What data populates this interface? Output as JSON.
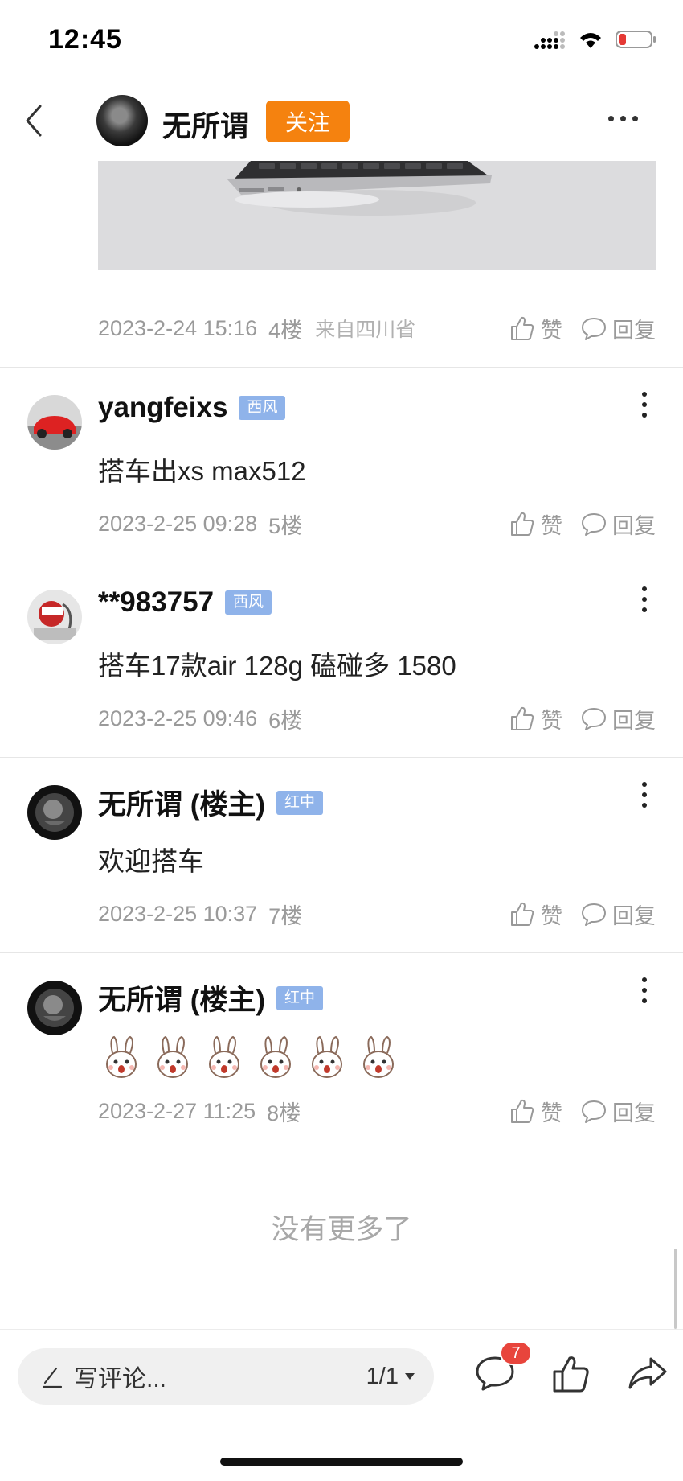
{
  "status_bar": {
    "time": "12:45"
  },
  "header": {
    "author_name": "无所谓",
    "follow_label": "关注"
  },
  "post": {
    "date": "2023-2-24 15:16",
    "floor": "4楼",
    "location": "来自四川省"
  },
  "actions": {
    "like_label": "赞",
    "reply_label": "回复"
  },
  "comments": [
    {
      "name": "yangfeixs",
      "badge": "西风",
      "text": "搭车出xs max512",
      "date": "2023-2-25 09:28",
      "floor": "5楼"
    },
    {
      "name": "**983757",
      "badge": "西风",
      "text": "搭车17款air 128g 磕碰多 1580",
      "date": "2023-2-25 09:46",
      "floor": "6楼"
    },
    {
      "name": "无所谓 (楼主)",
      "badge": "红中",
      "text": "欢迎搭车",
      "date": "2023-2-25 10:37",
      "floor": "7楼"
    },
    {
      "name": "无所谓 (楼主)",
      "badge": "红中",
      "text": "",
      "date": "2023-2-27 11:25",
      "floor": "8楼"
    }
  ],
  "footer": {
    "no_more": "没有更多了"
  },
  "bottom_bar": {
    "input_placeholder": "写评论...",
    "page_indicator": "1/1",
    "comment_count": "7"
  },
  "colors": {
    "follow_orange": "#f5820f",
    "badge_blue": "#8fb3ea",
    "count_red": "#e8453c"
  }
}
